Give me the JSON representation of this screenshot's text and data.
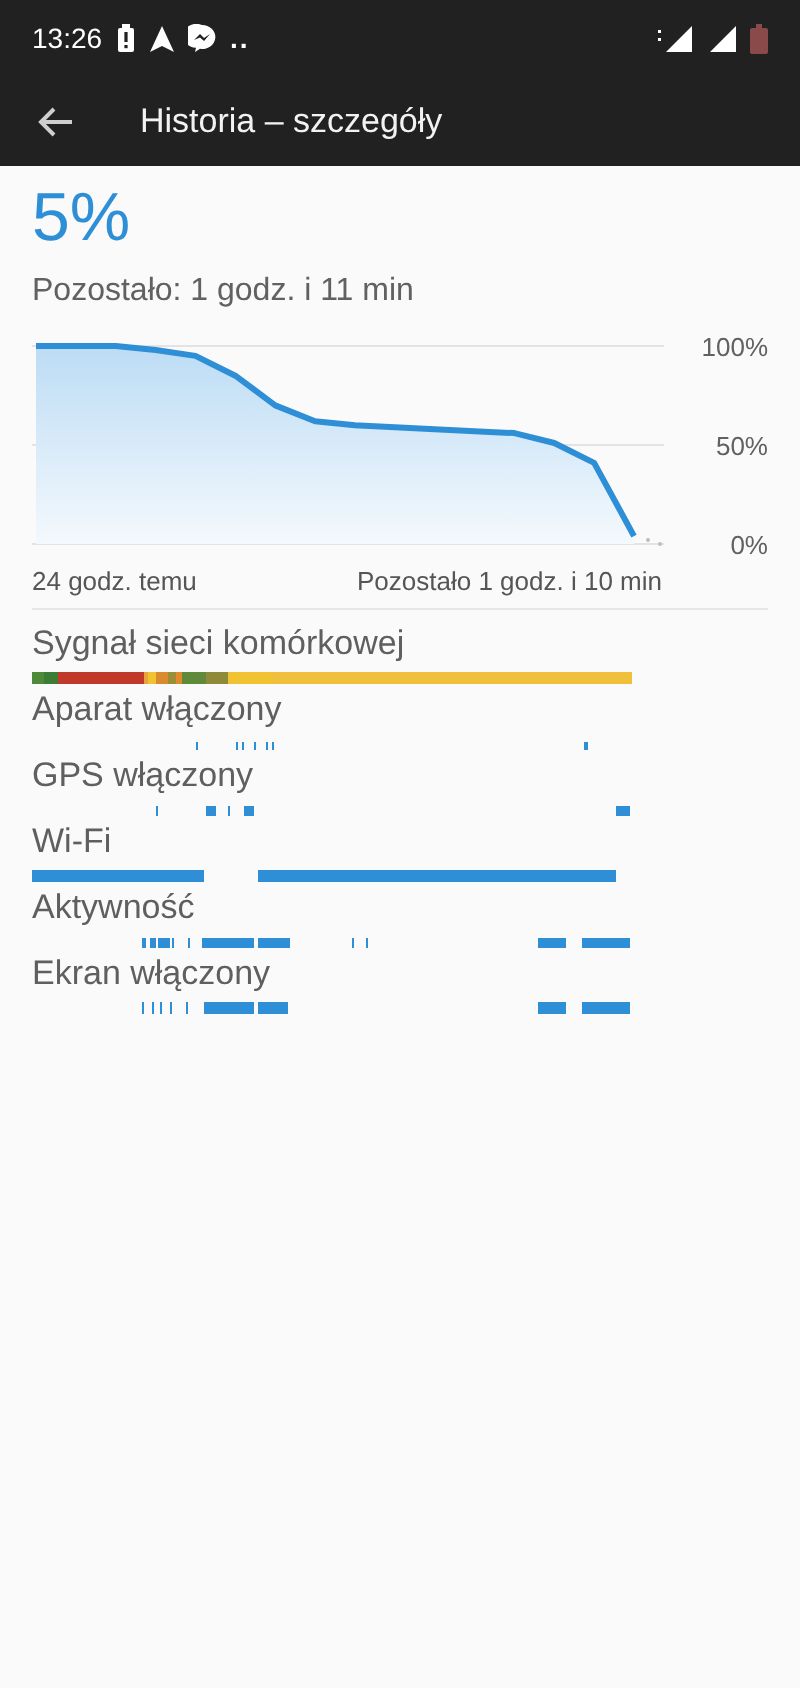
{
  "status_bar": {
    "time": "13:26",
    "more": ".."
  },
  "app_bar": {
    "title": "Historia – szczegóły"
  },
  "battery": {
    "percent": "5%",
    "remaining": "Pozostało: 1 godz. i 11 min"
  },
  "chart": {
    "chart_data": {
      "type": "area",
      "yticks": [
        {
          "value": 100,
          "label": "100%"
        },
        {
          "value": 50,
          "label": "50%"
        },
        {
          "value": 0,
          "label": "0%"
        }
      ],
      "ylim": [
        0,
        100
      ],
      "series": [
        {
          "color": "#2e8fd6",
          "values": [
            100,
            100,
            100,
            98,
            95,
            85,
            70,
            62,
            60,
            59,
            58,
            57,
            56,
            51,
            41,
            4
          ]
        }
      ]
    },
    "start_label": "24 godz. temu",
    "end_label": "Pozostało 1 godz. i 10 min"
  },
  "timelines": [
    {
      "label": "Sygnał sieci komórkowej",
      "kind": "signal"
    },
    {
      "label": "Aparat włączony",
      "kind": "camera"
    },
    {
      "label": "GPS włączony",
      "kind": "gps"
    },
    {
      "label": "Wi-Fi",
      "kind": "wifi"
    },
    {
      "label": "Aktywność",
      "kind": "activity"
    },
    {
      "label": "Ekran włączony",
      "kind": "screen"
    }
  ]
}
